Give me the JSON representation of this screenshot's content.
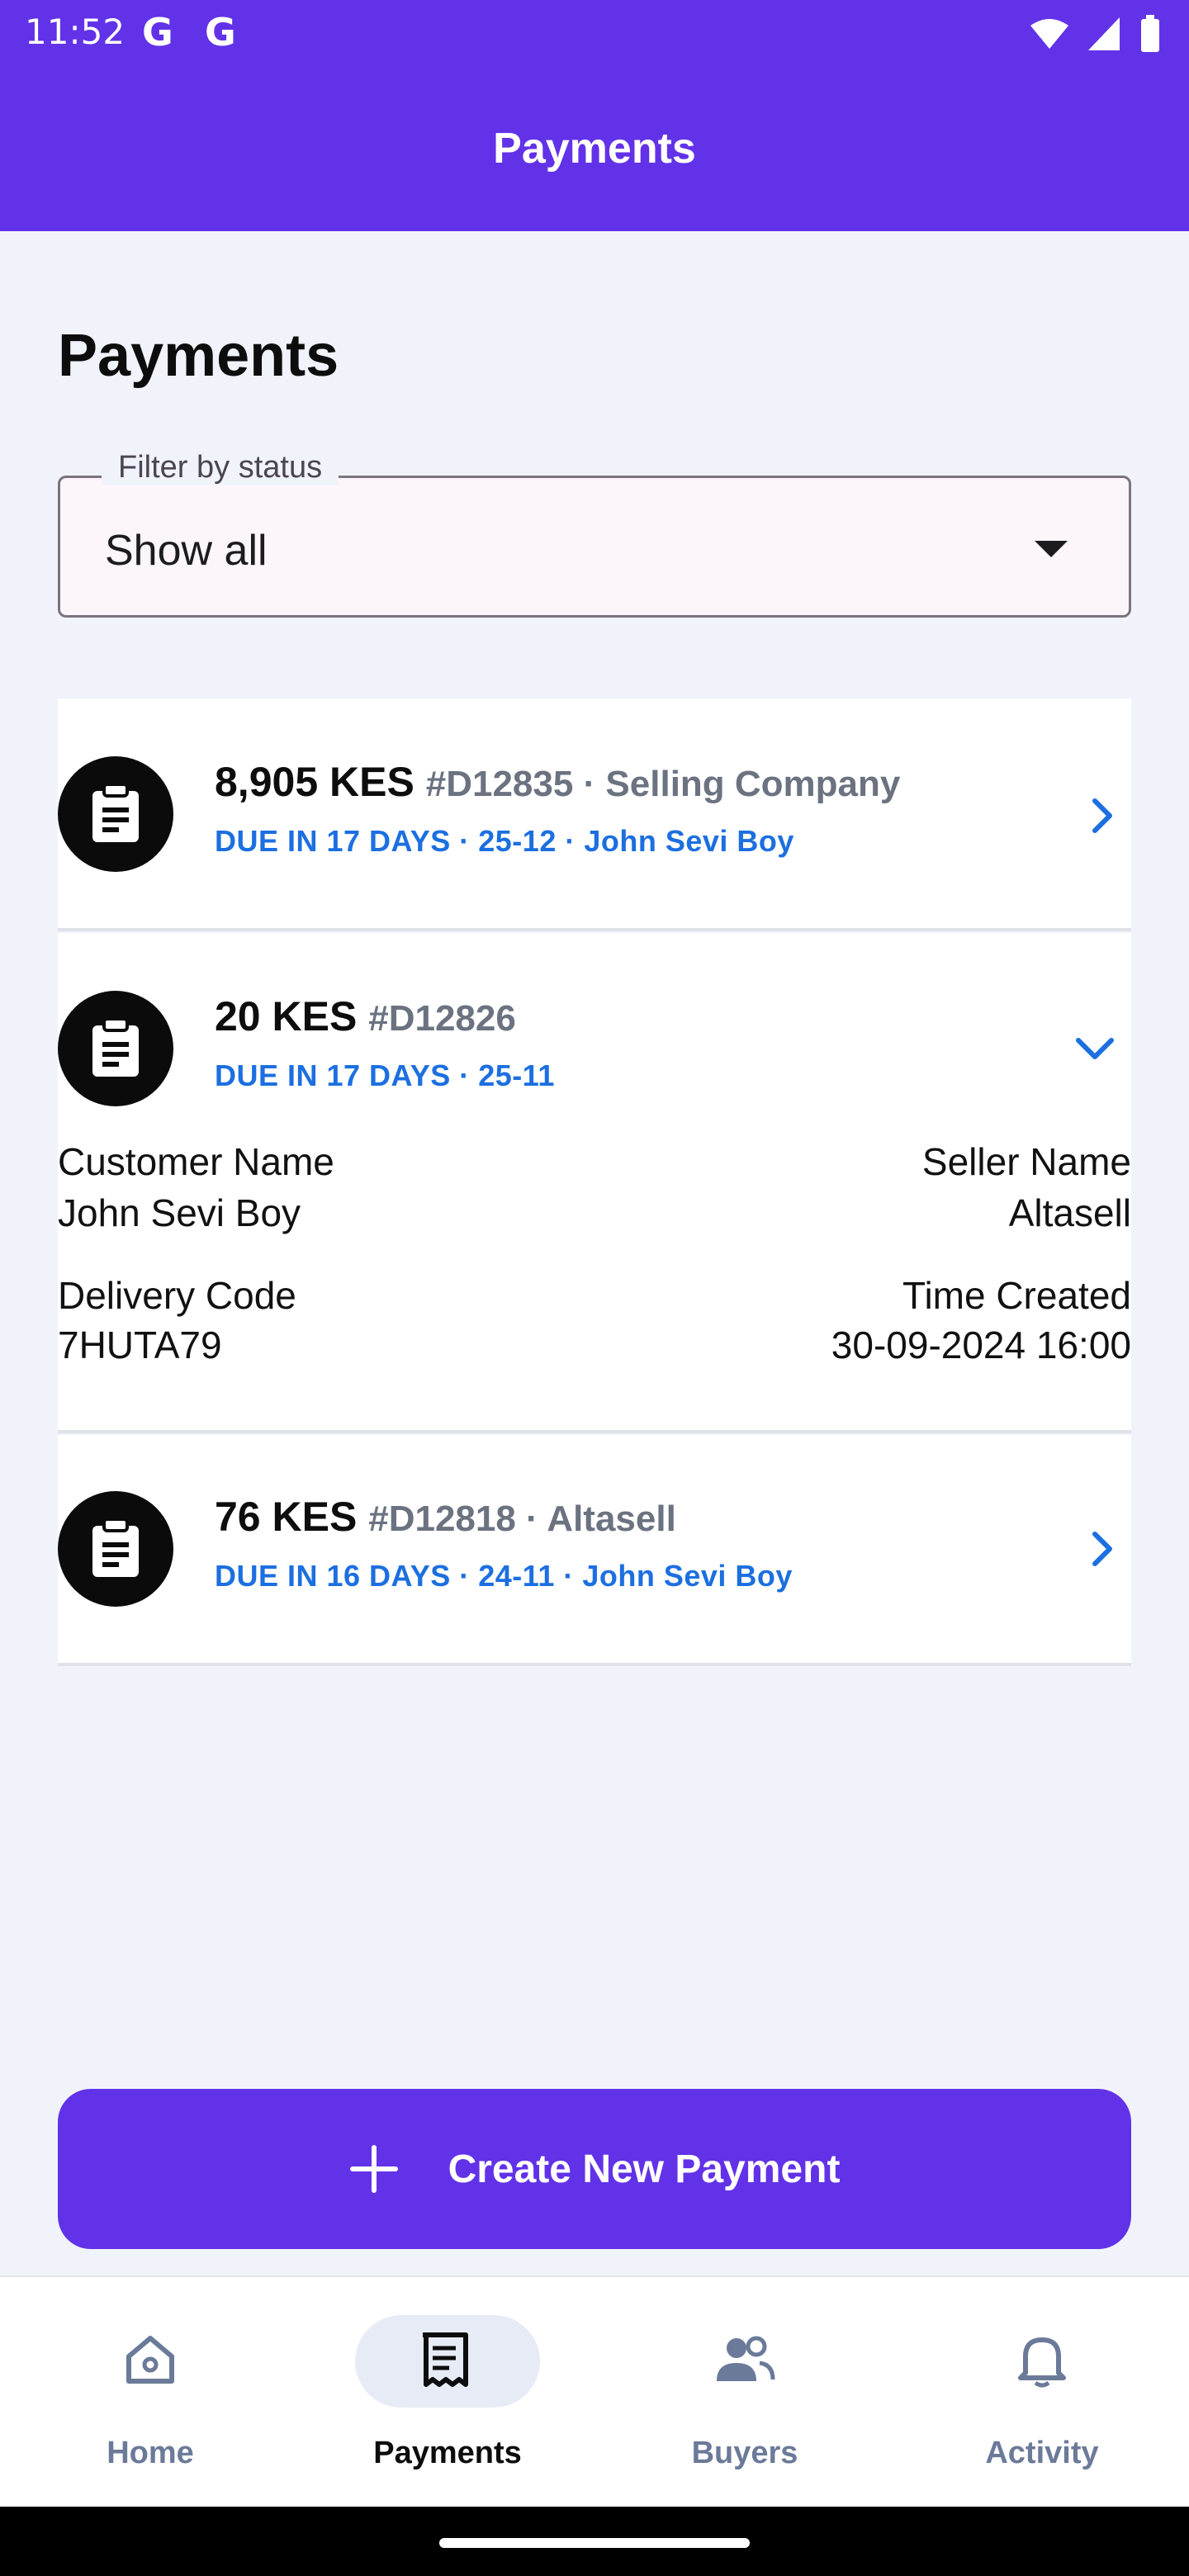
{
  "status_bar": {
    "time": "11:52",
    "g1": "G",
    "g2": "G"
  },
  "app_bar": {
    "title": "Payments"
  },
  "page": {
    "title": "Payments"
  },
  "filter": {
    "label": "Filter by status",
    "value": "Show all"
  },
  "payments": [
    {
      "amount": "8,905 KES",
      "meta": "#D12835 · Selling Company",
      "subline": "DUE IN 17 DAYS · 25-12 · John Sevi Boy"
    },
    {
      "amount": "20 KES",
      "meta": "#D12826",
      "subline": "DUE IN 17 DAYS · 25-11",
      "details": {
        "customer_label": "Customer Name",
        "customer_value": "John Sevi Boy",
        "seller_label": "Seller Name",
        "seller_value": "Altasell",
        "delivery_label": "Delivery Code",
        "delivery_value": "7HUTA79",
        "time_label": "Time Created",
        "time_value": "30-09-2024 16:00"
      }
    },
    {
      "amount": "76 KES",
      "meta": "#D12818 · Altasell",
      "subline": "DUE IN 16 DAYS · 24-11 · John Sevi Boy"
    }
  ],
  "create_button": {
    "label": "Create New Payment"
  },
  "bottom_nav": [
    {
      "label": "Home",
      "icon": "home-icon"
    },
    {
      "label": "Payments",
      "icon": "receipt-icon",
      "active": true
    },
    {
      "label": "Buyers",
      "icon": "people-icon"
    },
    {
      "label": "Activity",
      "icon": "bell-icon"
    }
  ],
  "colors": {
    "primary": "#6232E8",
    "link_blue": "#1C6FE0",
    "background": "#F1F3FB"
  }
}
